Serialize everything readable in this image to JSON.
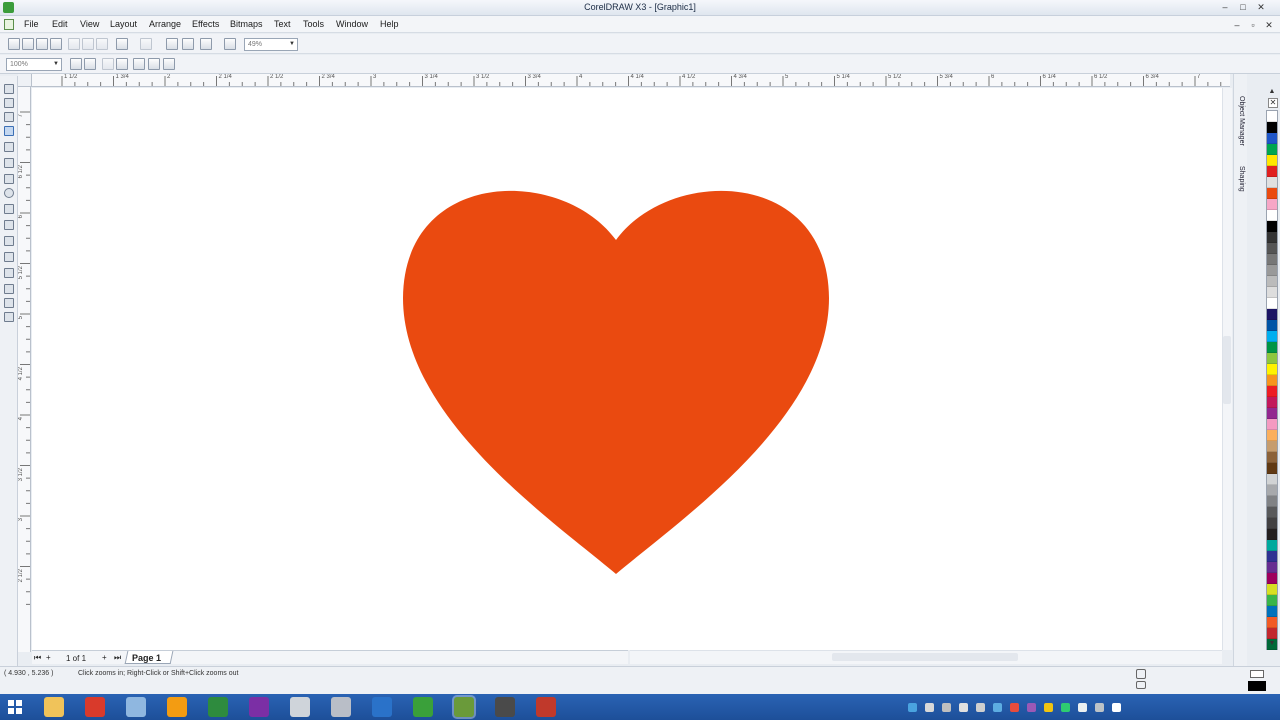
{
  "window": {
    "title": "CorelDRAW X3 - [Graphic1]"
  },
  "menu": [
    "File",
    "Edit",
    "View",
    "Layout",
    "Arrange",
    "Effects",
    "Bitmaps",
    "Text",
    "Tools",
    "Window",
    "Help"
  ],
  "toolbar": {
    "zoom_value": "49%",
    "zoom2_value": "100%"
  },
  "rulers": {
    "h_labels": [
      "1 1/2",
      "1 3/4",
      "2",
      "2 1/4",
      "2 1/2",
      "2 3/4",
      "3",
      "3 1/4",
      "3 1/2",
      "3 3/4",
      "4",
      "4 1/4",
      "4 1/2",
      "4 3/4",
      "5",
      "5 1/4",
      "5 1/2",
      "5 3/4",
      "6",
      "6 1/4",
      "6 1/2",
      "6 3/4",
      "7"
    ],
    "v_labels": [
      "7",
      "6 1/2",
      "6",
      "5 1/2",
      "5",
      "4 1/2",
      "4",
      "3 1/2",
      "3",
      "2 1/2"
    ]
  },
  "dockers": {
    "tabs": [
      "Object Manager",
      "Shaping"
    ]
  },
  "canvas": {
    "heart_color": "#ea4a10"
  },
  "palette": [
    "#ffffff",
    "#000000",
    "#1f56c8",
    "#00a650",
    "#ffe600",
    "#e02020",
    "#e0e0e0",
    "#ea4a10",
    "#f7a6c6",
    "#ffffff",
    "#000000",
    "#333333",
    "#555555",
    "#777777",
    "#999999",
    "#bbbbbb",
    "#dddddd",
    "#ffffff",
    "#1b1464",
    "#0054a6",
    "#00aeef",
    "#009444",
    "#8dc63f",
    "#fff200",
    "#f7941d",
    "#ed1c24",
    "#c2185b",
    "#92278f",
    "#f49ac1",
    "#fbaf5d",
    "#c69c6d",
    "#8c6239",
    "#603913",
    "#d1d3d4",
    "#a7a9ac",
    "#808285",
    "#58595b",
    "#414042",
    "#231f20",
    "#00a99d",
    "#2e3192",
    "#662d91",
    "#9e005d",
    "#d7df23",
    "#39b54a",
    "#0072bc",
    "#f15a24",
    "#c1272d",
    "#006838"
  ],
  "page_nav": {
    "count_text": "1 of 1",
    "page_tab": "Page 1"
  },
  "status": {
    "coords": "( 4.930 , 5.236 )",
    "hint": "Click zooms in; Right-Click or Shift+Click zooms out"
  },
  "taskbar": {
    "apps": [
      "file-explorer-icon",
      "chrome-icon",
      "folder-icon",
      "outlook-icon",
      "excel-icon",
      "onenote-icon",
      "car-icon",
      "document-icon",
      "browser-icon",
      "globe-icon",
      "coreldraw-icon",
      "tools-icon",
      "paint-icon"
    ]
  }
}
